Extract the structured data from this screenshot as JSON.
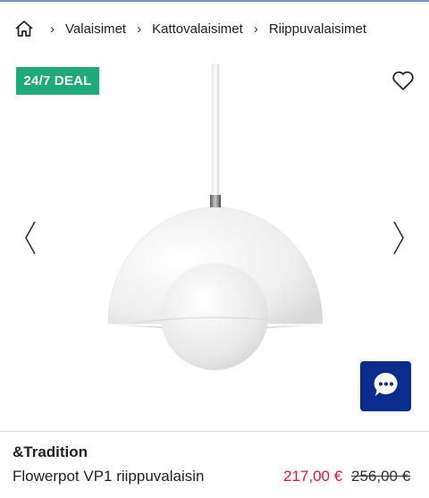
{
  "breadcrumb": {
    "home_icon": "home-icon",
    "separator": "›",
    "items": [
      "Valaisimet",
      "Kattovalaisimet",
      "Riippuvalaisimet"
    ]
  },
  "badge": {
    "label": "24/7 DEAL",
    "color": "#1faa7a"
  },
  "icons": {
    "favorite": "heart-icon",
    "prev": "chevron-left-icon",
    "next": "chevron-right-icon",
    "chat": "chat-bubble-icon"
  },
  "product": {
    "brand": "&Tradition",
    "name": "Flowerpot VP1 riippuvalaisin",
    "price_current": "217,00 €",
    "price_original": "256,00 €",
    "price_color": "#e3143a"
  },
  "colors": {
    "chat_button": "#0b2c8f",
    "accent_line": "#6f8fd8"
  }
}
